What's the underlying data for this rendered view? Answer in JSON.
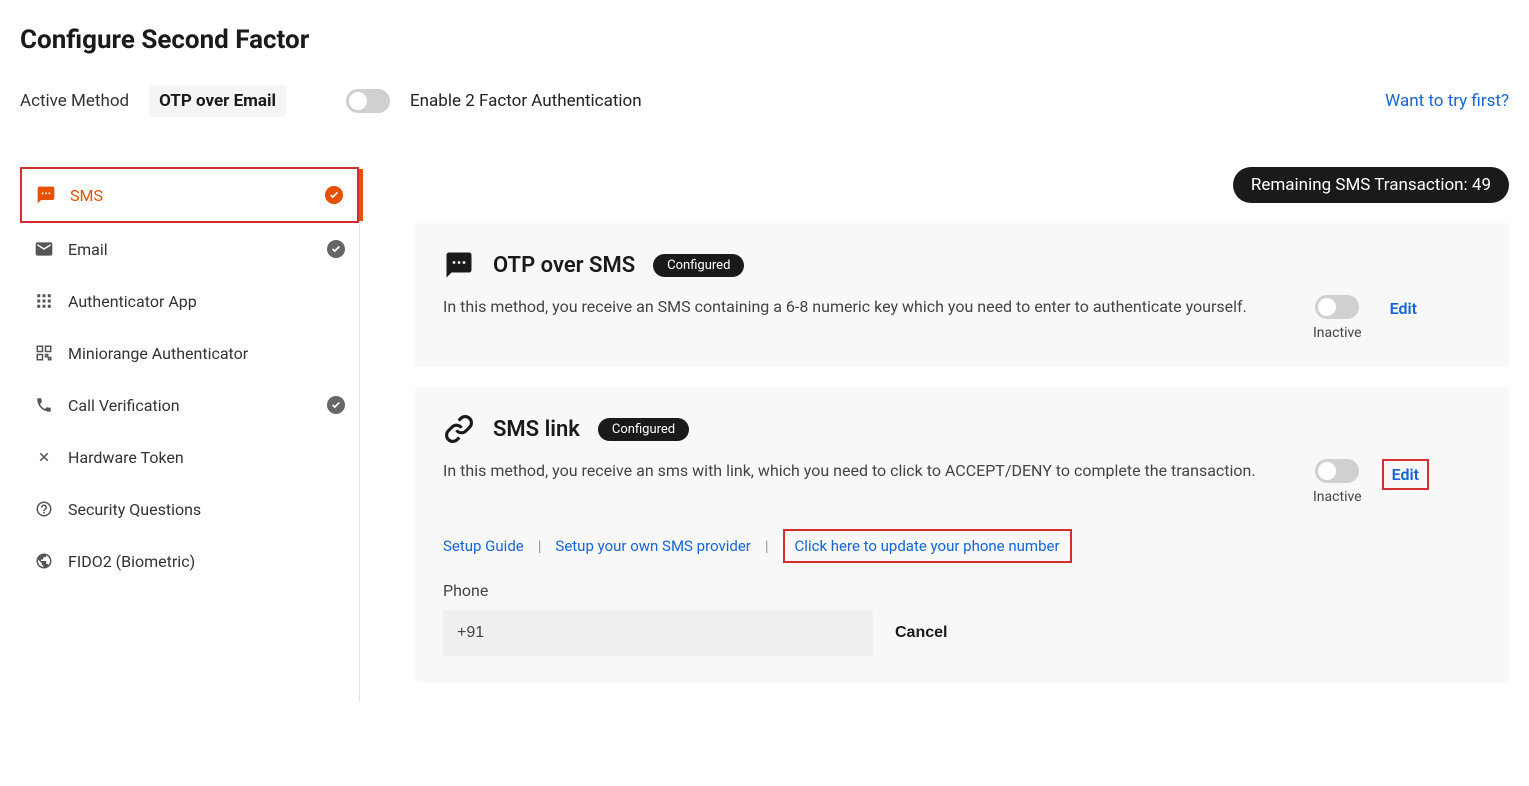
{
  "page_title": "Configure Second Factor",
  "active_method_label": "Active Method",
  "active_method_value": "OTP over Email",
  "enable_2fa_label": "Enable 2 Factor Authentication",
  "try_first_link": "Want to try first?",
  "sidebar": {
    "items": [
      {
        "label": "SMS",
        "icon": "sms-icon",
        "active": true,
        "checked": "orange"
      },
      {
        "label": "Email",
        "icon": "email-icon",
        "active": false,
        "checked": "gray"
      },
      {
        "label": "Authenticator App",
        "icon": "grid-icon",
        "active": false,
        "checked": null
      },
      {
        "label": "Miniorange Authenticator",
        "icon": "qr-icon",
        "active": false,
        "checked": null
      },
      {
        "label": "Call Verification",
        "icon": "phone-icon",
        "active": false,
        "checked": "gray"
      },
      {
        "label": "Hardware Token",
        "icon": "token-icon",
        "active": false,
        "checked": null
      },
      {
        "label": "Security Questions",
        "icon": "question-icon",
        "active": false,
        "checked": null
      },
      {
        "label": "FIDO2 (Biometric)",
        "icon": "biometric-icon",
        "active": false,
        "checked": null
      }
    ]
  },
  "sms_remaining_badge": "Remaining SMS Transaction: 49",
  "cards": {
    "otp_sms": {
      "title": "OTP over SMS",
      "badge": "Configured",
      "desc": "In this method, you receive an SMS containing a 6-8 numeric key which you need to enter to authenticate yourself.",
      "status": "Inactive",
      "edit": "Edit"
    },
    "sms_link": {
      "title": "SMS link",
      "badge": "Configured",
      "desc": "In this method, you receive an sms with link, which you need to click to ACCEPT/DENY to complete the transaction.",
      "status": "Inactive",
      "edit": "Edit",
      "links": {
        "setup_guide": "Setup Guide",
        "setup_provider": "Setup your own SMS provider",
        "update_phone": "Click here to update your phone number"
      },
      "phone_label": "Phone",
      "phone_value": "+91",
      "cancel": "Cancel"
    }
  }
}
